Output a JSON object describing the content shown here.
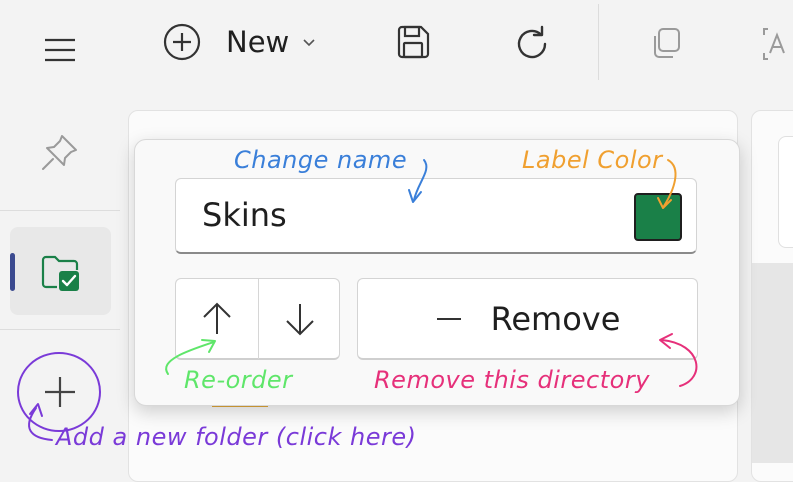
{
  "toolbar": {
    "new_label": "New",
    "icons": [
      "menu-icon",
      "add-circle-icon",
      "chevron-down-icon",
      "save-icon",
      "refresh-icon",
      "copy-icon",
      "text-recognition-icon"
    ]
  },
  "sidebar": {
    "items": [
      {
        "icon": "pin-icon"
      },
      {
        "icon": "folder-check-icon",
        "selected": true
      },
      {
        "icon": "plus-icon"
      }
    ]
  },
  "flyout": {
    "name_value": "Skins",
    "label_color": "#1a8048",
    "remove_label": "Remove",
    "move_up": "arrow-up-icon",
    "move_down": "arrow-down-icon"
  },
  "annotations": {
    "change_name": "Change name",
    "label_color": "Label Color",
    "reorder": "Re-order",
    "remove_dir": "Remove this directory",
    "add_folder": "Add a new folder (click here)"
  },
  "colors": {
    "blue": "#3a7fd9",
    "orange": "#f0a030",
    "green": "#5fe66a",
    "pink": "#e6307a",
    "purple": "#7a3ad8",
    "accent": "#3b4a8f"
  }
}
